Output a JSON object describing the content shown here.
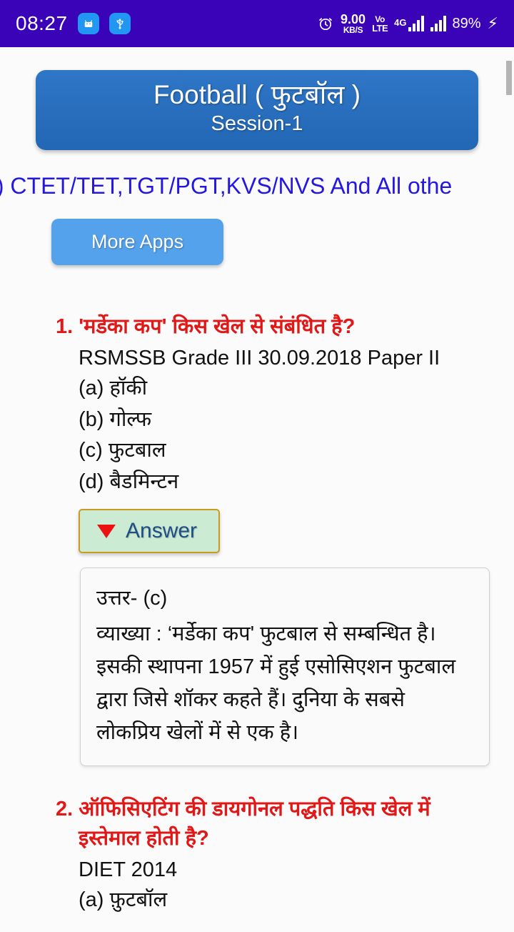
{
  "status_bar": {
    "clock": "08:27",
    "icons": [
      "android-robot-icon",
      "usb-icon",
      "alarm-icon"
    ],
    "network_speed_value": "9.00",
    "network_speed_unit": "KB/S",
    "volte_line1": "Vo",
    "volte_line2": "LTE",
    "network_type": "4G",
    "battery_percent": "89%",
    "charging": "⚡",
    "background_color": "#3b03b8"
  },
  "banner": {
    "title": "Football ( फुटबॉल )",
    "subtitle": "Session-1",
    "background_color": "#2267b4"
  },
  "marquee": {
    "text": "ाकूद) CTET/TET,TGT/PGT,KVS/NVS And All othe",
    "color": "#2417e0"
  },
  "more_apps": {
    "label": "More Apps",
    "background_color": "#55a2ec"
  },
  "questions": [
    {
      "number": "1.",
      "title": "'मर्डेका कप' किस खेल से संबंधित है?",
      "source": "RSMSSB Grade III 30.09.2018 Paper II",
      "options": [
        "(a) हॉकी",
        "(b) गोल्फ",
        "(c) फुटबाल",
        "(d) बैडमिन्टन"
      ],
      "answer_toggle_label": "Answer",
      "answer_text": "उत्तर- (c)",
      "explanation": "व्याख्या : ‘मर्डेका कप' फुटबाल से सम्बन्धित है। इसकी स्थापना 1957 में हुई एसोसिएशन फुटबाल द्वारा जिसे शॉकर कहते हैं। दुनिया के सबसे लोकप्रिय खेलों में से एक है।"
    },
    {
      "number": "2.",
      "title": "ऑफिसिएटिंग की डायगोनल पद्धति किस खेल में इस्तेमाल होती है?",
      "source": "DIET 2014",
      "options": [
        "(a) फ़ुटबॉल"
      ]
    }
  ],
  "colors": {
    "question_red": "#e01818",
    "answer_button_bg": "#ccebd3",
    "answer_button_border": "#cc9a20",
    "answer_label_blue": "#1f4e87"
  }
}
